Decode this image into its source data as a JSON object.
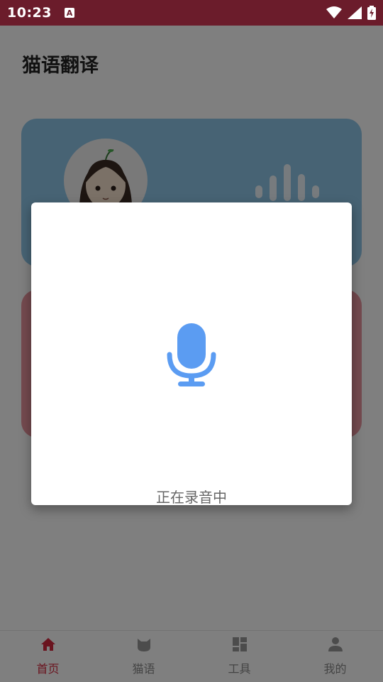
{
  "status_bar": {
    "time": "10:23",
    "notification_glyph": "A",
    "icons": [
      "wifi-icon",
      "signal-icon",
      "battery-charging-icon"
    ],
    "color": "#6b1c2b"
  },
  "page": {
    "title": "猫语翻译"
  },
  "cards": {
    "top_color": "#8fc6e9",
    "bottom_color": "#e8949f",
    "top_icons": [
      "avatar",
      "sound-wave-icon"
    ]
  },
  "dialog": {
    "icon": "microphone-icon",
    "icon_color": "#5b9cf2",
    "status_text": "正在录音中"
  },
  "bottom_nav": {
    "active_color": "#d4283f",
    "items": [
      {
        "label": "首页",
        "icon": "home-icon",
        "active": true
      },
      {
        "label": "猫语",
        "icon": "cat-icon",
        "active": false
      },
      {
        "label": "工具",
        "icon": "grid-icon",
        "active": false
      },
      {
        "label": "我的",
        "icon": "person-icon",
        "active": false
      }
    ]
  }
}
